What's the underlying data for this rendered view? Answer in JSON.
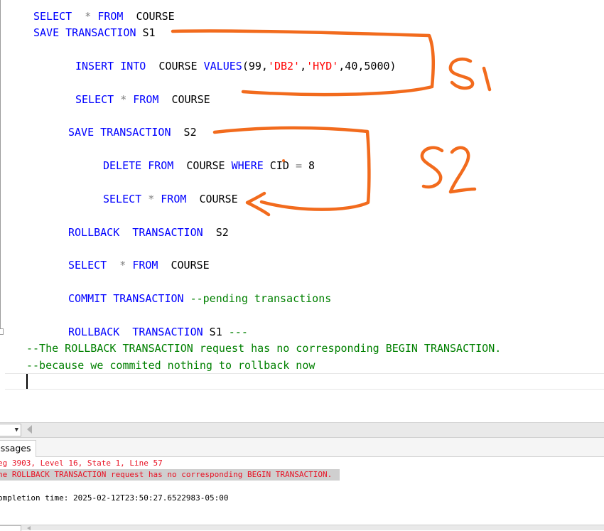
{
  "editor": {
    "lines": [
      [
        {
          "t": "SELECT",
          "c": "kw"
        },
        {
          "t": "  ",
          "c": ""
        },
        {
          "t": "*",
          "c": "op"
        },
        {
          "t": " ",
          "c": ""
        },
        {
          "t": "FROM",
          "c": "kw"
        },
        {
          "t": "  COURSE",
          "c": ""
        }
      ],
      [
        {
          "t": "SAVE TRANSACTION",
          "c": "kw"
        },
        {
          "t": " S1",
          "c": ""
        }
      ],
      [
        {
          "t": "INSERT INTO",
          "c": "kw"
        },
        {
          "t": "  COURSE ",
          "c": ""
        },
        {
          "t": "VALUES",
          "c": "kw"
        },
        {
          "t": "(99,",
          "c": ""
        },
        {
          "t": "'DB2'",
          "c": "str"
        },
        {
          "t": ",",
          "c": ""
        },
        {
          "t": "'HYD'",
          "c": "str"
        },
        {
          "t": ",40,5000)",
          "c": ""
        }
      ],
      [
        {
          "t": "SELECT",
          "c": "kw"
        },
        {
          "t": " ",
          "c": ""
        },
        {
          "t": "*",
          "c": "op"
        },
        {
          "t": " ",
          "c": ""
        },
        {
          "t": "FROM",
          "c": "kw"
        },
        {
          "t": "  COURSE",
          "c": ""
        }
      ],
      [
        {
          "t": "SAVE TRANSACTION",
          "c": "kw"
        },
        {
          "t": "  S2",
          "c": ""
        }
      ],
      [
        {
          "t": "DELETE FROM",
          "c": "kw"
        },
        {
          "t": "  COURSE ",
          "c": ""
        },
        {
          "t": "WHERE",
          "c": "kw"
        },
        {
          "t": " CID ",
          "c": ""
        },
        {
          "t": "=",
          "c": "op"
        },
        {
          "t": " 8",
          "c": ""
        }
      ],
      [
        {
          "t": "SELECT",
          "c": "kw"
        },
        {
          "t": " ",
          "c": ""
        },
        {
          "t": "*",
          "c": "op"
        },
        {
          "t": " ",
          "c": ""
        },
        {
          "t": "FROM",
          "c": "kw"
        },
        {
          "t": "  COURSE",
          "c": ""
        }
      ],
      [
        {
          "t": "ROLLBACK  TRANSACTION",
          "c": "kw"
        },
        {
          "t": "  S2",
          "c": ""
        }
      ],
      [
        {
          "t": "SELECT",
          "c": "kw"
        },
        {
          "t": "  ",
          "c": ""
        },
        {
          "t": "*",
          "c": "op"
        },
        {
          "t": " ",
          "c": ""
        },
        {
          "t": "FROM",
          "c": "kw"
        },
        {
          "t": "  COURSE",
          "c": ""
        }
      ],
      [
        {
          "t": "COMMIT TRANSACTION",
          "c": "kw"
        },
        {
          "t": " ",
          "c": ""
        },
        {
          "t": "--pending transactions",
          "c": "cm"
        }
      ],
      [
        {
          "t": "ROLLBACK  TRANSACTION",
          "c": "kw"
        },
        {
          "t": " S1 ",
          "c": ""
        },
        {
          "t": "---",
          "c": "cm"
        }
      ],
      [
        {
          "t": "--The ROLLBACK TRANSACTION request has no corresponding BEGIN TRANSACTION.",
          "c": "cm"
        }
      ],
      [
        {
          "t": "--because we commited nothing to rollback now",
          "c": "cm"
        }
      ]
    ],
    "annotations": [
      "S1",
      "S2"
    ]
  },
  "results": {
    "tab_label": "essages",
    "messages": [
      {
        "text": "eg 3903, Level 16, State 1, Line 57",
        "kind": "error"
      },
      {
        "text": "he ROLLBACK TRANSACTION request has no corresponding BEGIN TRANSACTION.",
        "kind": "error-selected"
      },
      {
        "text": "ompletion time: 2025-02-12T23:50:27.6522983-05:00",
        "kind": "plain"
      }
    ]
  },
  "colors": {
    "keyword": "#0000ff",
    "string": "#ff0000",
    "comment": "#008000",
    "operator": "#808080",
    "error": "#e81123",
    "ink": "#f26b1d"
  }
}
